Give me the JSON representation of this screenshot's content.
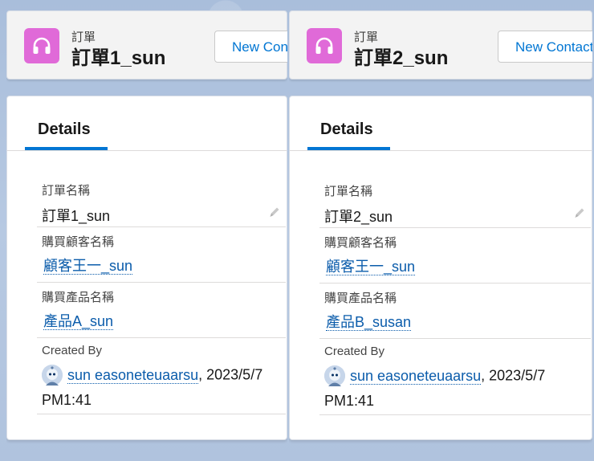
{
  "panels": [
    {
      "header": {
        "object_type": "訂單",
        "record_title": "訂單1_sun",
        "new_button_label": "New Contact"
      },
      "tab_label": "Details",
      "fields": {
        "order_name_label": "訂單名稱",
        "order_name_value": "訂單1_sun",
        "customer_label": "購買顧客名稱",
        "customer_value": "顧客王一_sun",
        "product_label": "購買產品名稱",
        "product_value": "產品A_sun",
        "created_by_label": "Created By",
        "created_by_user": "sun easoneteuaarsu",
        "created_by_date": "2023/5/7",
        "created_by_time": "PM1:41"
      }
    },
    {
      "header": {
        "object_type": "訂單",
        "record_title": "訂單2_sun",
        "new_button_label": "New Contact"
      },
      "tab_label": "Details",
      "fields": {
        "order_name_label": "訂單名稱",
        "order_name_value": "訂單2_sun",
        "customer_label": "購買顧客名稱",
        "customer_value": "顧客王一_sun",
        "product_label": "購買產品名稱",
        "product_value": "產品B_susan",
        "created_by_label": "Created By",
        "created_by_user": "sun easoneteuaarsu",
        "created_by_date": "2023/5/7",
        "created_by_time": "PM1:41"
      }
    }
  ],
  "icons": {
    "object_icon": "headset-icon",
    "edit_icon": "pencil-icon",
    "avatar": "astro-avatar-icon"
  },
  "colors": {
    "object_icon_bg": "#e06ad8",
    "link": "#0b5cab",
    "tab_active": "#0176d3",
    "background": "#b0c4df"
  }
}
